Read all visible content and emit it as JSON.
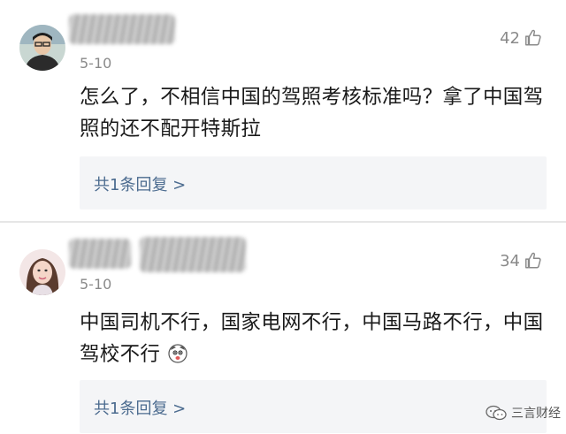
{
  "comments": [
    {
      "date": "5-10",
      "likes": "42",
      "text": "怎么了，不相信中国的驾照考核标准吗？拿了中国驾照的还不配开特斯拉",
      "reply_link": "共1条回复 >"
    },
    {
      "date": "5-10",
      "likes": "34",
      "text": "中国司机不行，国家电网不行，中国马路不行，中国驾校不行",
      "reply_link": "共1条回复 >"
    }
  ],
  "watermark": {
    "text": "三言财经"
  },
  "colors": {
    "link": "#4b6b8f",
    "reply_bg": "#f4f5f7",
    "meta": "#8a8a8a"
  }
}
